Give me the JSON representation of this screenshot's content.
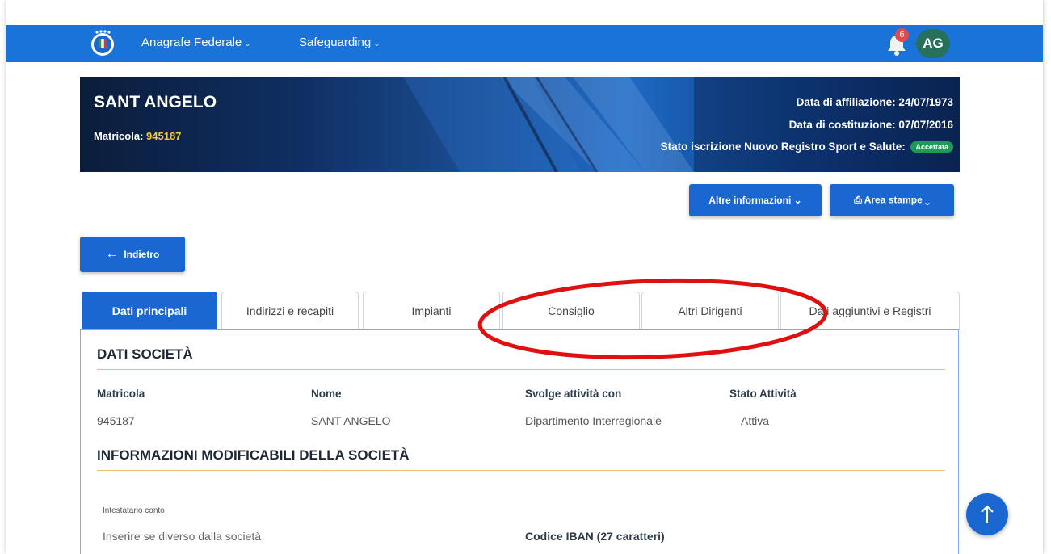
{
  "nav": {
    "items": [
      {
        "label": "Anagrafe Federale"
      },
      {
        "label": "Safeguarding"
      }
    ],
    "notification_count": "6",
    "avatar_initials": "AG"
  },
  "hero": {
    "name": "SANT ANGELO",
    "matricola_label": "Matricola:",
    "matricola_value": "945187",
    "affiliazione": "Data di affiliazione: 24/07/1973",
    "costituzione": "Data di costituzione: 07/07/2016",
    "stato_label": "Stato iscrizione Nuovo Registro Sport e Salute:",
    "stato_value": "Accettata"
  },
  "actions": {
    "altre_info": "Altre informazioni",
    "area_stampe": "Area stampe",
    "back": "Indietro"
  },
  "tabs": [
    {
      "label": "Dati principali",
      "active": true
    },
    {
      "label": "Indirizzi e recapiti"
    },
    {
      "label": "Impianti"
    },
    {
      "label": "Consiglio"
    },
    {
      "label": "Altri Dirigenti"
    },
    {
      "label": "Dati aggiuntivi e Registri"
    }
  ],
  "section_dati": {
    "title": "DATI SOCIETÀ",
    "columns": [
      {
        "label": "Matricola",
        "value": "945187"
      },
      {
        "label": "Nome",
        "value": "SANT ANGELO"
      },
      {
        "label": "Svolge attività con",
        "value": "Dipartimento Interregionale"
      },
      {
        "label": "Stato Attività",
        "value": "Attiva"
      }
    ]
  },
  "section_info": {
    "title": "INFORMAZIONI MODIFICABILI DELLA SOCIETÀ",
    "intestatario_label": "Intestatario conto",
    "intestatario_placeholder": "Inserire se diverso dalla società",
    "iban_label": "Codice IBAN (27 caratteri)"
  },
  "colors": {
    "primary": "#1a67d2",
    "nav": "#1a73d9",
    "accent_line": "#e8bf6a",
    "annotation": "#e01010",
    "success": "#1d9a55"
  }
}
